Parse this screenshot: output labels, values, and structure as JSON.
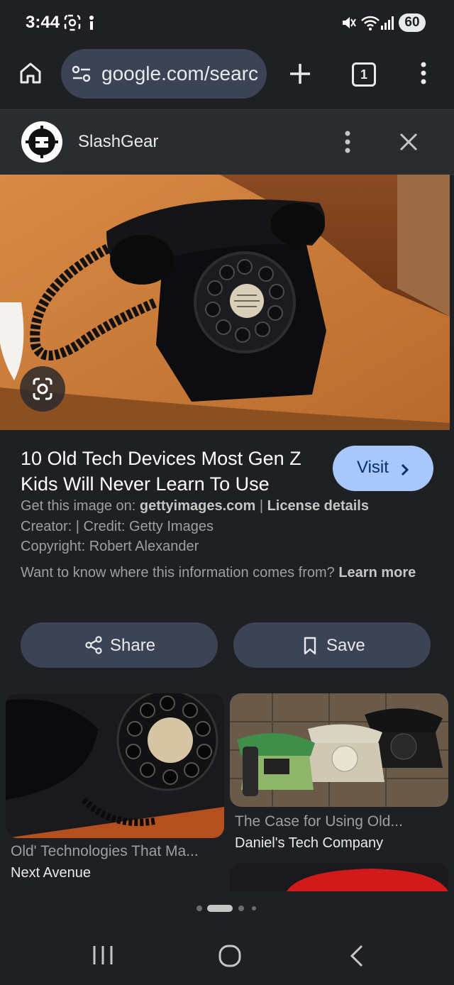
{
  "status_bar": {
    "time": "3:44",
    "battery": "60"
  },
  "browser": {
    "url": "google.com/search",
    "tab_count": "1"
  },
  "source": {
    "name": "SlashGear"
  },
  "result": {
    "title": "10 Old Tech Devices Most Gen Z Kids Will Never Learn To Use",
    "visit_label": "Visit",
    "get_image_prefix": "Get this image on: ",
    "get_image_site": "gettyimages.com",
    "separator": " | ",
    "license_label": "License details",
    "creator_line": "Creator: | Credit: Getty Images",
    "copyright_line": "Copyright: Robert Alexander",
    "info_question": "Want to know where this information comes from? ",
    "learn_more": "Learn more"
  },
  "actions": {
    "share_label": "Share",
    "save_label": "Save"
  },
  "related": [
    {
      "title": "Old' Technologies That Ma...",
      "source": "Next Avenue"
    },
    {
      "title": "The Case for Using Old...",
      "source": "Daniel's Tech Company"
    }
  ],
  "colors": {
    "background": "#1f2023",
    "accent": "#a8c7fa",
    "button": "#3c4354"
  }
}
